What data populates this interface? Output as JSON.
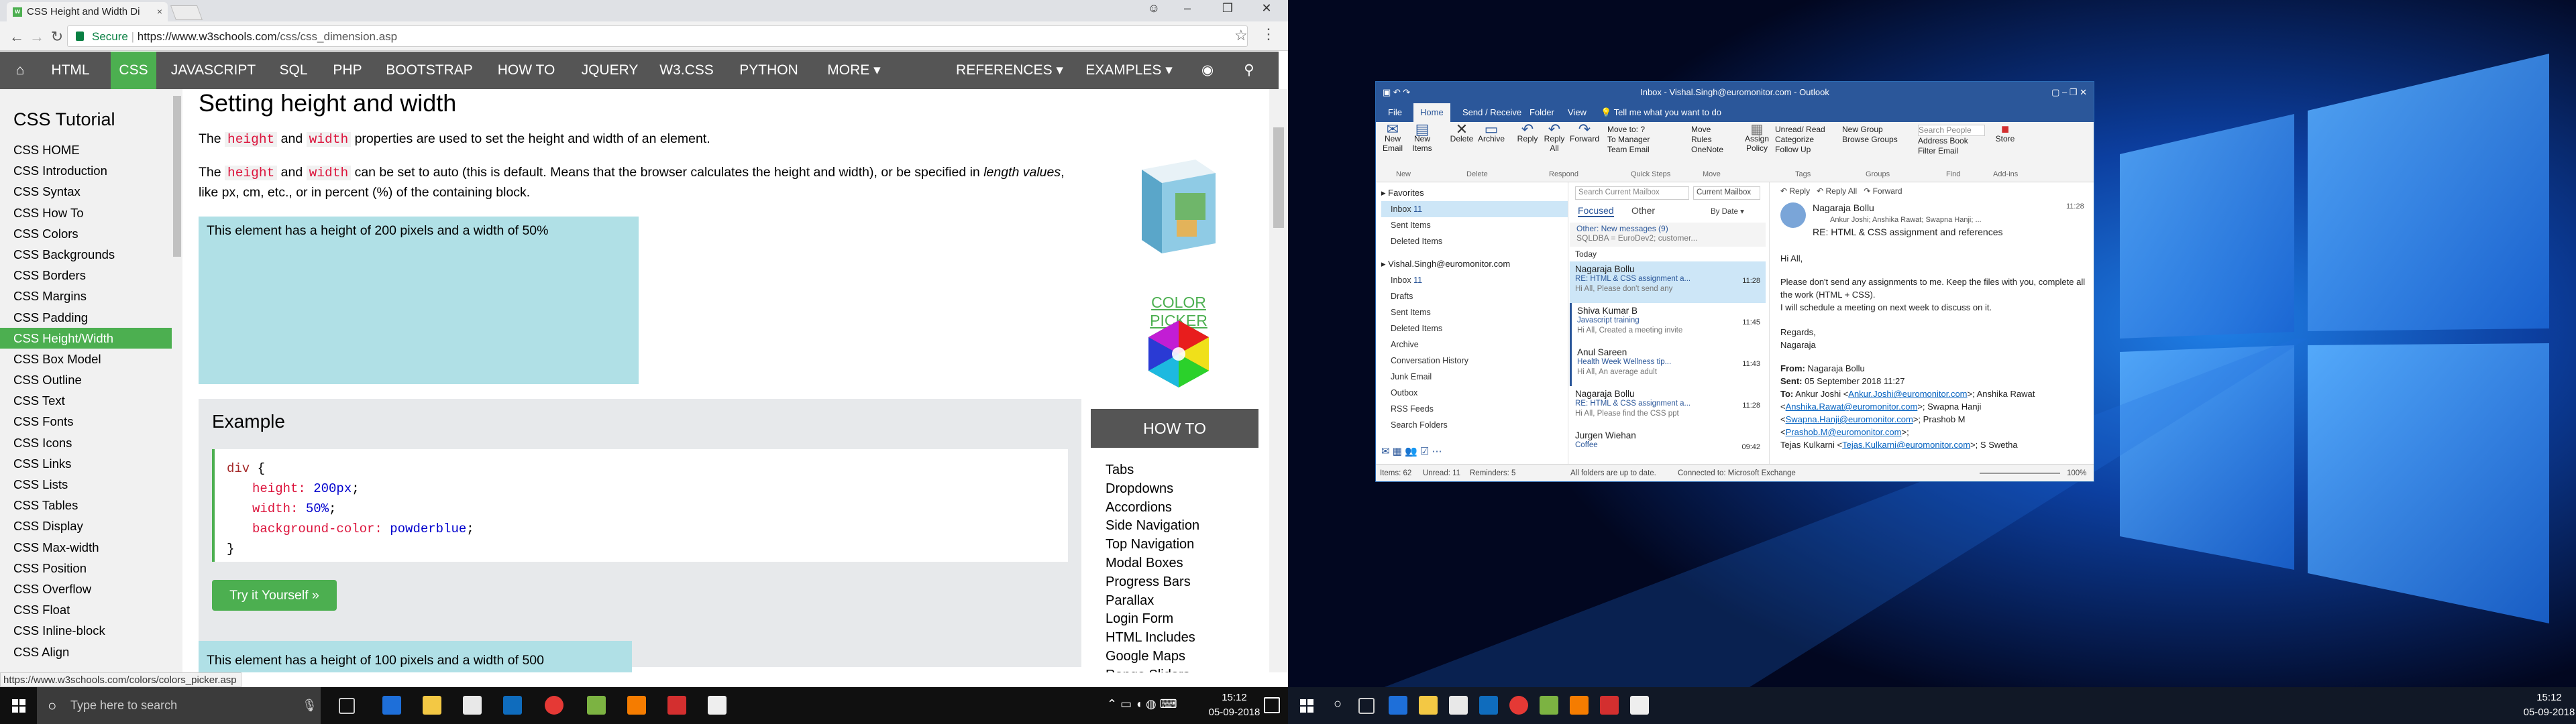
{
  "chrome": {
    "tab_title": "CSS Height and Width Di",
    "secure_label": "Secure",
    "url_host": "https://www.w3schools.com",
    "url_path": "/css/css_dimension.asp",
    "status_url": "https://www.w3schools.com/colors/colors_picker.asp"
  },
  "w3nav": {
    "items": [
      "HTML",
      "CSS",
      "JAVASCRIPT",
      "SQL",
      "PHP",
      "BOOTSTRAP",
      "HOW TO",
      "JQUERY",
      "W3.CSS",
      "PYTHON",
      "MORE ▾",
      "REFERENCES ▾",
      "EXAMPLES ▾"
    ],
    "active": "CSS"
  },
  "sidebar": {
    "heading": "CSS Tutorial",
    "items": [
      "CSS HOME",
      "CSS Introduction",
      "CSS Syntax",
      "CSS How To",
      "CSS Colors",
      "CSS Backgrounds",
      "CSS Borders",
      "CSS Margins",
      "CSS Padding",
      "CSS Height/Width",
      "CSS Box Model",
      "CSS Outline",
      "CSS Text",
      "CSS Fonts",
      "CSS Icons",
      "CSS Links",
      "CSS Lists",
      "CSS Tables",
      "CSS Display",
      "CSS Max-width",
      "CSS Position",
      "CSS Overflow",
      "CSS Float",
      "CSS Inline-block",
      "CSS Align"
    ],
    "active_index": 9
  },
  "main": {
    "heading": "Setting height and width",
    "p1_a": "The",
    "p1_kw1": "height",
    "p1_and": "and",
    "p1_kw2": "width",
    "p1_b": "properties are used to set the height and width of an element.",
    "p2_a": "The",
    "p2_kw1": "height",
    "p2_and": "and",
    "p2_kw2": "width",
    "p2_b": "can be set to auto (this is default. Means that the browser calculates the height and width), or be specified in",
    "p2_c_em": "length values",
    "p2_d": ", like px, cm, etc., or in percent (%) of the containing block.",
    "demo200_text": "This element has a height of 200 pixels and a width of 50%",
    "color_picker": "COLOR PICKER",
    "example_heading": "Example",
    "code": {
      "l1_tag": "div",
      "l1_brace": " {",
      "l2_prop": "height:",
      "l2_val": " 200px",
      "l3_prop": "width:",
      "l3_val": " 50%",
      "l4_prop": "background-color:",
      "l4_val": " powderblue",
      "semi": ";",
      "l5": "}"
    },
    "tryit": "Try it Yourself »",
    "demo100_text": "This element has a height of 100 pixels and a width of 500"
  },
  "howto": {
    "heading": "HOW TO",
    "items": [
      "Tabs",
      "Dropdowns",
      "Accordions",
      "Side Navigation",
      "Top Navigation",
      "Modal Boxes",
      "Progress Bars",
      "Parallax",
      "Login Form",
      "HTML Includes",
      "Google Maps",
      "Range Sliders"
    ]
  },
  "taskbar_left": {
    "search_placeholder": "Type here to search",
    "time": "15:12",
    "date": "05-09-2018"
  },
  "taskbar_right": {
    "time": "15:12",
    "date": "05-09-2018"
  },
  "outlook": {
    "title": "Inbox - Vishal.Singh@euromonitor.com  -  Outlook",
    "tabs": [
      "File",
      "Home",
      "Send / Receive",
      "Folder",
      "View"
    ],
    "tell_me": "Tell me what you want to do",
    "ribbon": {
      "new_email": "New Email",
      "new_items": "New Items",
      "delete": "Delete",
      "archive": "Archive",
      "reply": "Reply",
      "reply_all": "Reply All",
      "forward": "Forward",
      "move_to": "Move to: ?",
      "to_manager": "To Manager",
      "team_email": "Team Email",
      "move": "Move",
      "rules": "Rules",
      "onenote": "OneNote",
      "assign_policy": "Assign Policy",
      "unread_read": "Unread/ Read",
      "categorize": "Categorize",
      "follow_up": "Follow Up",
      "new_group": "New Group",
      "browse_groups": "Browse Groups",
      "search_people": "Search People",
      "address_book": "Address Book",
      "filter_email": "Filter Email",
      "store": "Store",
      "groups": [
        "New",
        "Delete",
        "Respond",
        "Quick Steps",
        "Move",
        "Tags",
        "Groups",
        "Find",
        "Add-ins"
      ]
    },
    "folders": {
      "favorites": "Favorites",
      "fav_items": [
        "Inbox",
        "Sent Items",
        "Deleted Items"
      ],
      "inbox_count": "11",
      "account": "Vishal.Singh@euromonitor.com",
      "acct_items": [
        "Inbox",
        "Drafts",
        "Sent Items",
        "Deleted Items",
        "Archive",
        "Conversation History",
        "Junk Email",
        "Outbox",
        "RSS Feeds",
        "Search Folders"
      ],
      "acct_inbox_count": "11"
    },
    "list": {
      "search": "Search Current Mailbox",
      "scope": "Current Mailbox",
      "focused": "Focused",
      "other": "Other",
      "sort": "By Date ▾",
      "other_msgs": "Other: New messages (9)",
      "other_preview": "SQLDBA = EuroDev2; customer...",
      "today": "Today",
      "items": [
        {
          "from": "Nagaraja Bollu",
          "subj": "RE: HTML & CSS assignment a...",
          "prev": "Hi All,  Please don't send any",
          "time": "11:28"
        },
        {
          "from": "Shiva Kumar B",
          "subj": "Javascript training",
          "prev": "Hi All,  Created a meeting invite",
          "time": "11:45"
        },
        {
          "from": "Anul Sareen",
          "subj": "Health Week   Wellness tip...",
          "prev": "Hi All,  An average adult",
          "time": "11:43"
        },
        {
          "from": "Nagaraja Bollu",
          "subj": "RE: HTML & CSS assignment a...",
          "prev": "Hi All,  Please find the CSS ppt",
          "time": "11:28"
        },
        {
          "from": "Jurgen Wiehan",
          "subj": "Coffee",
          "prev": "",
          "time": "09:42"
        }
      ]
    },
    "reading": {
      "reply": "Reply",
      "reply_all": "Reply All",
      "forward": "Forward",
      "from_name": "Nagaraja Bollu",
      "recipients": "Ankur Joshi; Anshika Rawat; Swapna Hanji; ...",
      "time": "11:28",
      "subject": "RE: HTML & CSS assignment and references",
      "body_greeting": "Hi All,",
      "body_1": "Please don't send any assignments to me. Keep the files with you, complete all the work (HTML + CSS).",
      "body_2": "I will schedule a meeting on next week to discuss on it.",
      "body_regards": "Regards,",
      "body_sign": "Nagaraja",
      "fwd_from_label": "From:",
      "fwd_from": "Nagaraja Bollu",
      "fwd_sent_label": "Sent:",
      "fwd_sent": "05 September 2018 11:27",
      "fwd_to_label": "To:",
      "fwd_to_1": "Ankur Joshi <",
      "fwd_to_1_link": "Ankur.Joshi@euromonitor.com",
      "fwd_to_1b": ">; Anshika Rawat",
      "fwd_to_2a": "<",
      "fwd_to_2_link": "Anshika.Rawat@euromonitor.com",
      "fwd_to_2b": ">; Swapna Hanji",
      "fwd_to_3a": "<",
      "fwd_to_3_link": "Swapna.Hanji@euromonitor.com",
      "fwd_to_3b": ">; Prashob M <",
      "fwd_to_3_link2": "Prashob.M@euromonitor.com",
      "fwd_to_3c": ">;",
      "fwd_to_4a": "Tejas Kulkarni <",
      "fwd_to_4_link": "Tejas.Kulkarni@euromonitor.com",
      "fwd_to_4b": ">; S Swetha"
    },
    "status": {
      "items": "Items: 62",
      "unread": "Unread: 11",
      "reminders": "Reminders: 5",
      "synced": "All folders are up to date.",
      "connected": "Connected to: Microsoft Exchange",
      "zoom": "100%"
    }
  },
  "colors": {
    "w3_green": "#4caf50",
    "w3_nav": "#555555",
    "outlook_blue": "#2b579a",
    "desktop_bg": "#03082a"
  }
}
